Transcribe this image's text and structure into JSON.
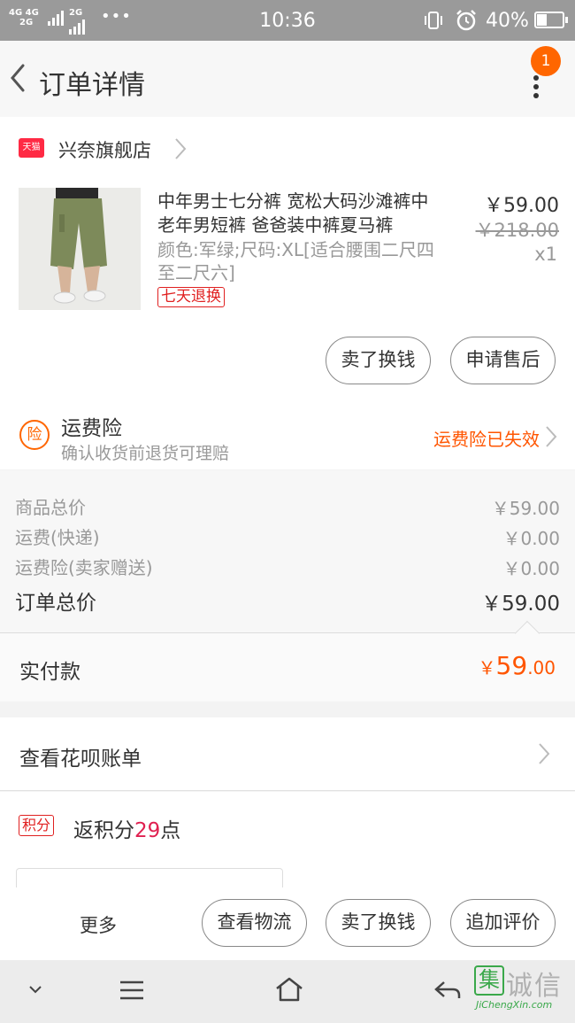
{
  "status_bar": {
    "network_top": "4G 4G",
    "network_bottom": "2G",
    "network3": "2G",
    "dots": "•••",
    "time": "10:36",
    "battery_percent": "40%",
    "battery_level": 0.4
  },
  "header": {
    "title": "订单详情",
    "badge_count": "1"
  },
  "shop": {
    "logo_text": "天猫",
    "name": "兴奈旗舰店"
  },
  "product": {
    "title": "中年男士七分裤 宽松大码沙滩裤中老年男短裤 爸爸装中裤夏马裤",
    "sku": "颜色:军绿;尺码:XL[适合腰围二尺四至二尺六]",
    "tag": "七天退换",
    "price": "￥59.00",
    "original_price": "￥218.00",
    "quantity": "x1",
    "actions": {
      "resell": "卖了换钱",
      "after_sale": "申请售后"
    }
  },
  "insurance": {
    "icon_text": "险",
    "title": "运费险",
    "subtitle": "确认收货前退货可理赔",
    "status": "运费险已失效"
  },
  "summary": {
    "rows": [
      {
        "label": "商品总价",
        "value": "￥59.00"
      },
      {
        "label": "运费(快递)",
        "value": "￥0.00"
      },
      {
        "label": "运费险(卖家赠送)",
        "value": "￥0.00"
      },
      {
        "label": "订单总价",
        "value": "￥59.00"
      }
    ]
  },
  "actual_payment": {
    "label": "实付款",
    "currency": "￥",
    "integer": "59",
    "decimal": ".00"
  },
  "huabei": {
    "label": "查看花呗账单"
  },
  "points": {
    "badge": "积分",
    "prefix": "返积分",
    "count": "29",
    "suffix": "点"
  },
  "bottom_bar": {
    "more": "更多",
    "logistics": "查看物流",
    "resell": "卖了换钱",
    "review": "追加评价"
  },
  "watermark": {
    "icon_char": "集",
    "text": "诚信",
    "sub": "JiChengXin.com"
  },
  "colors": {
    "accent": "#ff5500",
    "badge": "#ff6600",
    "tmall_red": "#ff2a44",
    "tag_red": "#e02020"
  }
}
